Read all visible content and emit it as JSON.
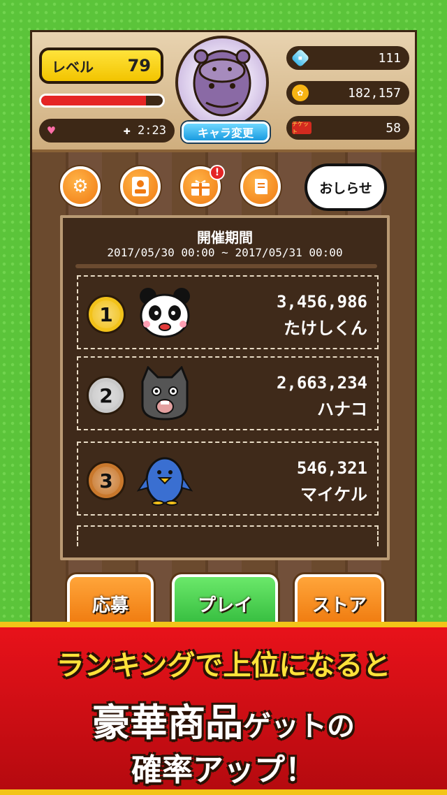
{
  "header": {
    "level_label": "レベル",
    "level_value": "79",
    "hp_fraction": 0.86,
    "heart_timer": "✚ 2:23",
    "chara_button": "キャラ変更",
    "gems": "111",
    "coins": "182,157",
    "tickets": "58",
    "ticket_icon_text": "チケット"
  },
  "nav": {
    "settings_icon": "gear-icon",
    "profile_icon": "profile-card-icon",
    "gift_icon": "gift-icon",
    "gift_badge": "!",
    "scroll_icon": "scroll-icon",
    "news_label": "おしらせ"
  },
  "board": {
    "period_title": "開催期間",
    "period_range": "2017/05/30 00:00 ~ 2017/05/31 00:00",
    "rankings": [
      {
        "rank": "1",
        "score": "3,456,986",
        "name": "たけしくん",
        "medal_color": "#f2c21a"
      },
      {
        "rank": "2",
        "score": "2,663,234",
        "name": "ハナコ",
        "medal_color": "#c9c9c9"
      },
      {
        "rank": "3",
        "score": "546,321",
        "name": "マイケル",
        "medal_color": "#c9782c"
      }
    ]
  },
  "buttons": {
    "apply": "応募",
    "play": "プレイ",
    "store": "ストア"
  },
  "banner": {
    "line1": "ランキングで上位になると",
    "line2_big": "豪華商品",
    "line2_small": "ゲットの",
    "line3": "確率アップ！"
  },
  "colors": {
    "background": "#5bc43a",
    "banner": "#e8121a",
    "play_button": "#3fcf45",
    "orange_button": "#f08a12"
  }
}
